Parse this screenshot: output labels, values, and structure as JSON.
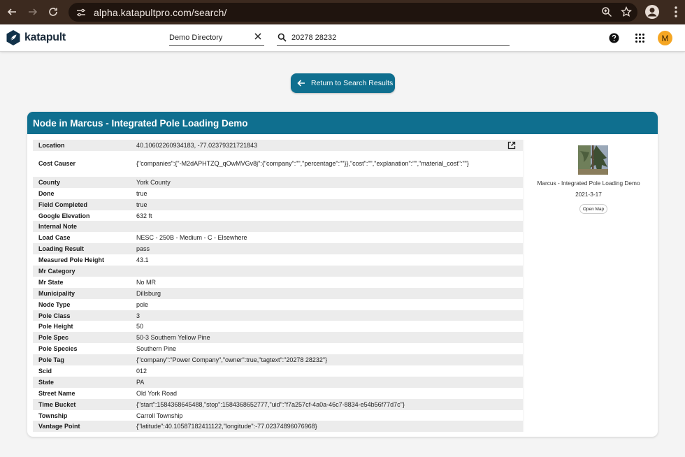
{
  "browser": {
    "url": "alpha.katapultpro.com/search/"
  },
  "app": {
    "logo_text": "katapult",
    "directory_value": "Demo Directory",
    "search_value": "20278 28232",
    "avatar_initial": "M",
    "accent_color": "#0f6f8f"
  },
  "return_button": {
    "label": "Return to Search Results"
  },
  "card": {
    "title": "Node in Marcus - Integrated Pole Loading Demo",
    "rows": [
      {
        "key": "Location",
        "value": "40.10602260934183, -77.02379321721843"
      },
      {
        "key": "Cost Causer",
        "value": "{\"companies\":{\"-M2dAPHTZQ_qOwMVGv8j\":{\"company\":\"\",\"percentage\":\"\"}},\"cost\":\"\",\"explanation\":\"\",\"material_cost\":\"\"}"
      },
      {
        "key": "County",
        "value": "York County"
      },
      {
        "key": "Done",
        "value": "true"
      },
      {
        "key": "Field Completed",
        "value": "true"
      },
      {
        "key": "Google Elevation",
        "value": "632 ft"
      },
      {
        "key": "Internal Note",
        "value": ""
      },
      {
        "key": "Load Case",
        "value": "NESC - 250B - Medium - C - Elsewhere"
      },
      {
        "key": "Loading Result",
        "value": "pass"
      },
      {
        "key": "Measured Pole Height",
        "value": "43.1"
      },
      {
        "key": "Mr Category",
        "value": ""
      },
      {
        "key": "Mr State",
        "value": "No MR"
      },
      {
        "key": "Municipality",
        "value": "Dillsburg"
      },
      {
        "key": "Node Type",
        "value": "pole"
      },
      {
        "key": "Pole Class",
        "value": "3"
      },
      {
        "key": "Pole Height",
        "value": "50"
      },
      {
        "key": "Pole Spec",
        "value": "50-3 Southern Yellow Pine"
      },
      {
        "key": "Pole Species",
        "value": "Southern Pine"
      },
      {
        "key": "Pole Tag",
        "value": "{\"company\":\"Power Company\",\"owner\":true,\"tagtext\":\"20278 28232\"}"
      },
      {
        "key": "Scid",
        "value": "012"
      },
      {
        "key": "State",
        "value": "PA"
      },
      {
        "key": "Street Name",
        "value": "Old York Road"
      },
      {
        "key": "Time Bucket",
        "value": "{\"start\":1584368645488,\"stop\":1584368652777,\"uid\":\"f7a257cf-4a0a-46c7-8834-e54b56f77d7c\"}"
      },
      {
        "key": "Township",
        "value": "Carroll Township"
      },
      {
        "key": "Vantage Point",
        "value": "{\"latitude\":40.10587182411122,\"longitude\":-77.02374896076968}"
      }
    ]
  },
  "photo": {
    "caption": "Marcus - Integrated Pole Loading Demo",
    "date": "2021-3-17",
    "open_map_label": "Open Map"
  }
}
